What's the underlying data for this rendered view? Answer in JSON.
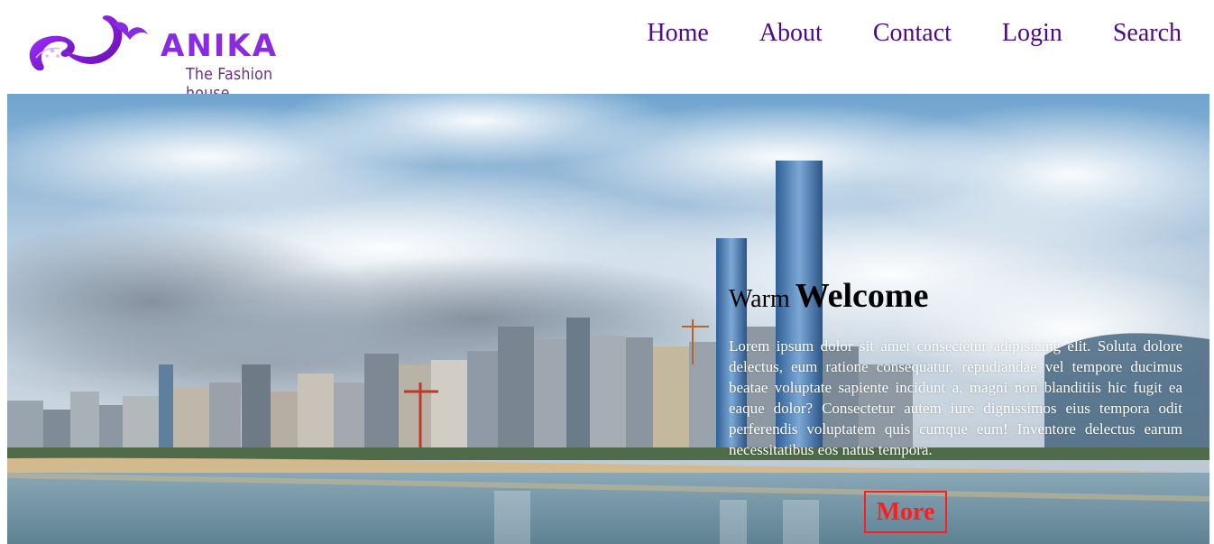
{
  "brand": {
    "name": "ANIKA",
    "tagline": "The Fashion house",
    "color": "#8a2be2"
  },
  "nav": {
    "items": [
      {
        "label": "Home"
      },
      {
        "label": "About"
      },
      {
        "label": "Contact"
      },
      {
        "label": "Login"
      },
      {
        "label": "Search"
      }
    ],
    "color": "#4b0a86"
  },
  "hero": {
    "image": "city-skyline-waterfront-photo",
    "welcome_small": "Warm",
    "welcome_big": "Welcome",
    "body": "Lorem ipsum dolor sit amet consectetur adipisicing elit. Soluta dolore delectus, eum ratione consequatur, repudiandae vel tempore ducimus beatae voluptate sapiente incidunt a, magni non blanditiis hic fugit ea eaque dolor? Consectetur autem iure dignissimos eius tempora odit perferendis voluptatem quis cumque eum! Inventore delectus earum necessitatibus eos natus tempora.",
    "more_label": "More",
    "more_color": "#ff1e1e"
  }
}
